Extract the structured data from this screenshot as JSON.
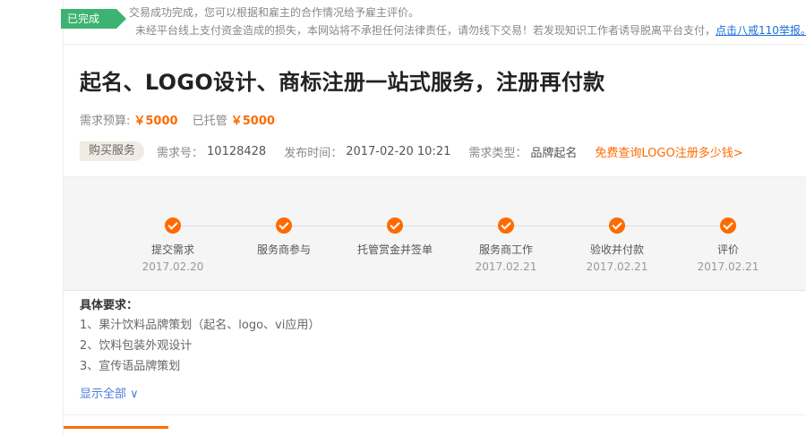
{
  "notice": {
    "status": "已完成",
    "line1": "交易成功完成，您可以根据和雇主的合作情况给予雇主评价。",
    "line2": "未经平台线上支付资金造成的损失，本网站将不承担任何法律责任，请勿线下交易！若发现知识工作者诱导脱离平台支付，",
    "report_link": "点击八戒110举报。"
  },
  "title": "起名、LOGO设计、商标注册一站式服务，注册再付款",
  "budget": {
    "label": "需求预算:",
    "amount": "￥5000",
    "escrow_label": "已托管",
    "escrow_amount": "￥5000"
  },
  "meta": {
    "tag": "购买服务",
    "id_label": "需求号：",
    "id_value": "10128428",
    "time_label": "发布时间：",
    "time_value": "2017-02-20 10:21",
    "type_label": "需求类型：",
    "type_value": "品牌起名",
    "promo_link": "免费查询LOGO注册多少钱>"
  },
  "steps": [
    {
      "label": "提交需求",
      "date": "2017.02.20"
    },
    {
      "label": "服务商参与",
      "date": ""
    },
    {
      "label": "托管赏金并签单",
      "date": ""
    },
    {
      "label": "服务商工作",
      "date": "2017.02.21"
    },
    {
      "label": "验收并付款",
      "date": "2017.02.21"
    },
    {
      "label": "评价",
      "date": "2017.02.21"
    }
  ],
  "requirements": {
    "title": "具体要求：",
    "items": [
      "1、果汁饮料品牌策划（起名、logo、vi应用）",
      "2、饮料包装外观设计",
      "3、宣传语品牌策划"
    ],
    "show_all": "显示全部 ∨"
  },
  "colors": {
    "accent": "#ff6a00",
    "success": "#3cb371",
    "link": "#4a7fd8"
  }
}
